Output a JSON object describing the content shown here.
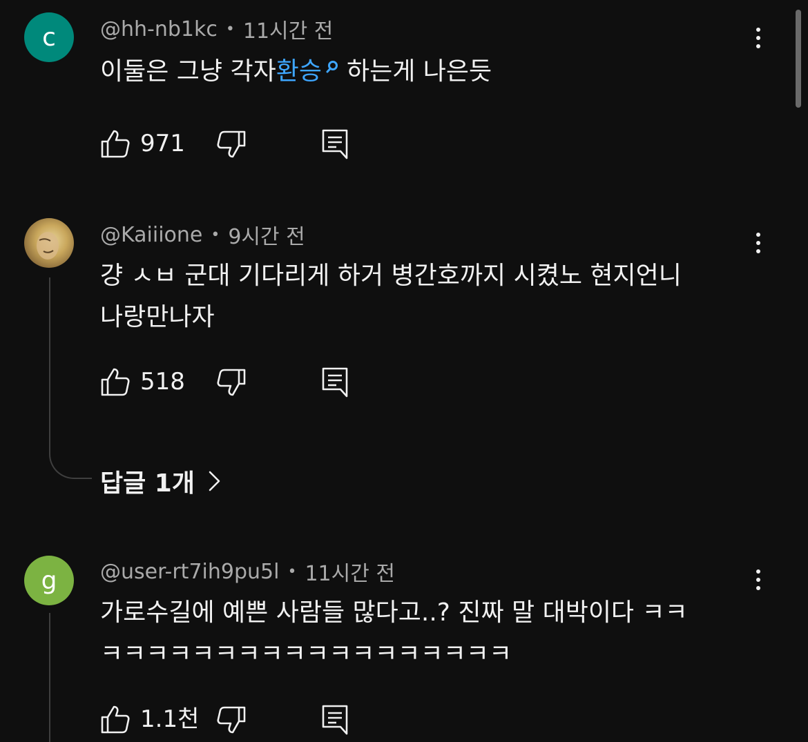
{
  "colors": {
    "background": "#0f0f0f",
    "text": "#f1f1f1",
    "meta": "#aaaaaa",
    "link": "#3ea6ff",
    "avatar_c": "#00897b",
    "avatar_g": "#7cb342"
  },
  "comments": [
    {
      "avatar_letter": "c",
      "author": "@hh-nb1kc",
      "time": "11시간 전",
      "text_before": "이둘은 그냥 각자",
      "text_link": "환승",
      "text_after": "하는게 나은듯",
      "likes": "971",
      "icons": [
        "like-icon",
        "dislike-icon",
        "reply-icon",
        "more-icon",
        "search-icon"
      ]
    },
    {
      "avatar_letter": "",
      "author": "@Kaiiione",
      "time": "9시간 전",
      "text_line1": "걍 ㅅㅂ 군대 기다리게 하거 병간호까지 시켰노 현지언니",
      "text_line2": "나랑만나자",
      "likes": "518",
      "replies_label": "답글 1개",
      "icons": [
        "like-icon",
        "dislike-icon",
        "reply-icon",
        "more-icon",
        "chevron-right-icon"
      ]
    },
    {
      "avatar_letter": "g",
      "author": "@user-rt7ih9pu5l",
      "time": "11시간 전",
      "text_line1": "가로수길에 예쁜 사람들 많다고..? 진짜 말 대박이다 ㅋㅋ",
      "text_line2": "ㅋㅋㅋㅋㅋㅋㅋㅋㅋㅋㅋㅋㅋㅋㅋㅋㅋㅋ",
      "likes": "1.1천",
      "icons": [
        "like-icon",
        "dislike-icon",
        "reply-icon",
        "more-icon"
      ]
    }
  ]
}
